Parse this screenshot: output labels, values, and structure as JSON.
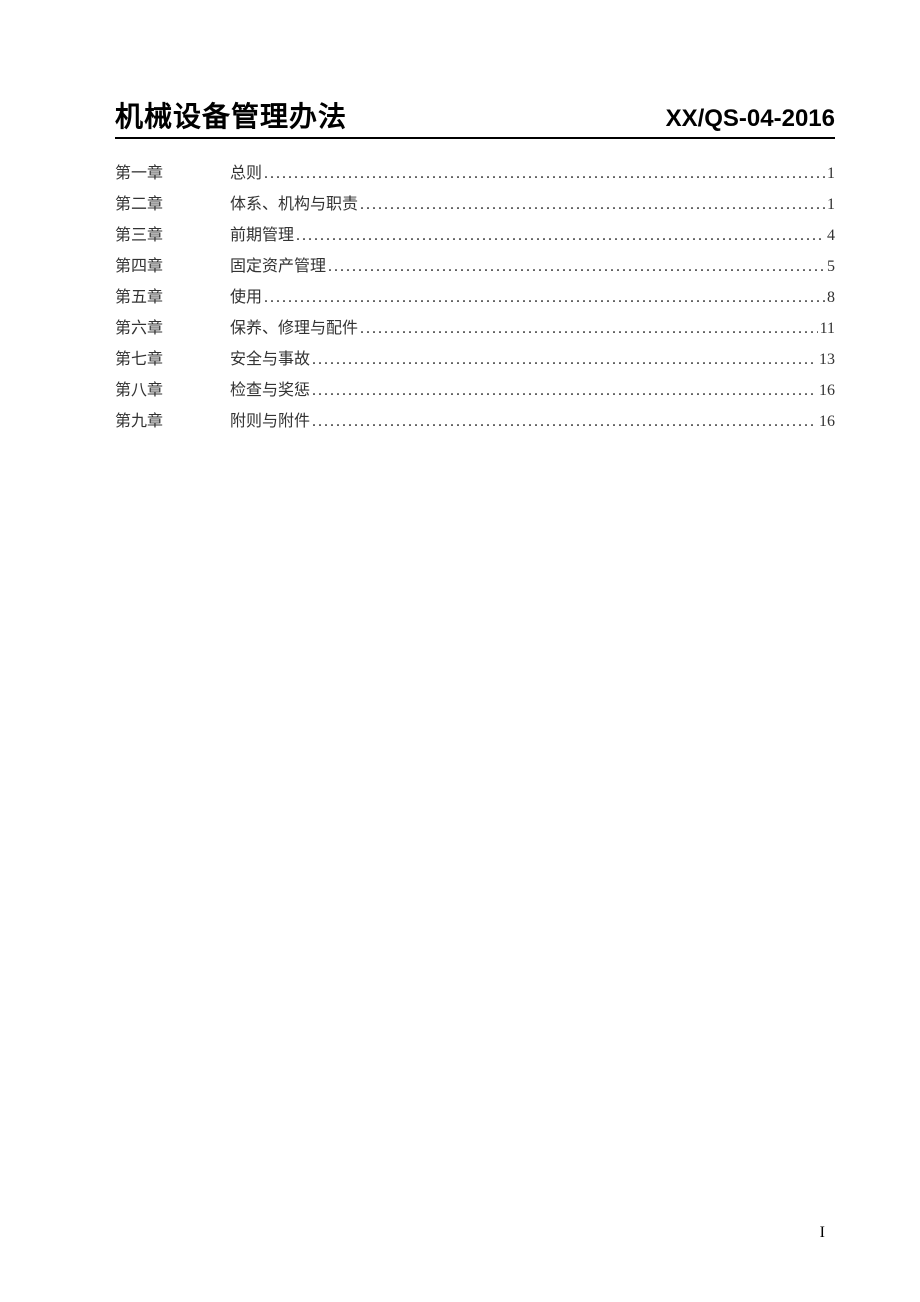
{
  "header": {
    "title": "机械设备管理办法",
    "code": "XX/QS-04-2016"
  },
  "toc": [
    {
      "chapter": "第一章",
      "name": "总则",
      "page": "1"
    },
    {
      "chapter": "第二章",
      "name": "体系、机构与职责",
      "page": "1"
    },
    {
      "chapter": "第三章",
      "name": "前期管理",
      "page": "4"
    },
    {
      "chapter": "第四章",
      "name": "固定资产管理",
      "page": "5"
    },
    {
      "chapter": "第五章",
      "name": "使用",
      "page": "8"
    },
    {
      "chapter": "第六章",
      "name": "保养、修理与配件",
      "page": "11"
    },
    {
      "chapter": "第七章",
      "name": "安全与事故",
      "page": "13"
    },
    {
      "chapter": "第八章",
      "name": "检查与奖惩",
      "page": "16"
    },
    {
      "chapter": "第九章",
      "name": "附则与附件",
      "page": "16"
    }
  ],
  "pageNumber": "I"
}
